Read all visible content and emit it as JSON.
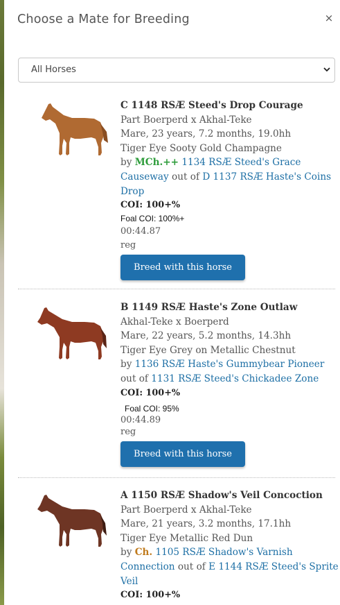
{
  "dialog": {
    "title": "Choose a Mate for Breeding",
    "close_label": "×"
  },
  "filter": {
    "selected": "All Horses"
  },
  "colors": {
    "link": "#1d6fa5",
    "button": "#1f70ad",
    "mch_badge": "#2e9c3b",
    "ch_badge": "#c07a1c"
  },
  "horses": [
    {
      "name": "C 1148 RSÆ Steed's Drop Courage",
      "breed": "Part Boerperd x Akhal-Teke",
      "details": "Mare, 23 years, 7.2 months, 19.0hh",
      "color": "Tiger Eye Sooty Gold Champagne",
      "by_label": "by",
      "sire_title": "MCh.++",
      "sire_line1": "1134 RSÆ Steed's Grace",
      "sire_line2": "Causeway",
      "out_of_label": "out of",
      "dam_line1": "D 1137 RSÆ Haste's Coins",
      "dam_line2": "Drop",
      "coi": "COI: 100+%",
      "foal_coi": "Foal COI: 100%+",
      "time": "00:44.87",
      "reg": "reg",
      "button": "Breed with this horse",
      "coat": "#b06a32"
    },
    {
      "name": "B 1149 RSÆ Haste's Zone Outlaw",
      "breed": "Akhal-Teke x Boerperd",
      "details": "Mare, 22 years, 5.2 months, 14.3hh",
      "color": "Tiger Eye Grey on Metallic Chestnut",
      "by_label": "by",
      "sire": "1136 RSÆ Haste's Gummybear Pioneer",
      "out_of_label": "out of",
      "dam": "1131 RSÆ Steed's Chickadee Zone",
      "coi": "COI: 100+%",
      "foal_coi": "Foal COI: 95%",
      "time": "00:44.89",
      "reg": "reg",
      "button": "Breed with this horse",
      "coat": "#8e3a22"
    },
    {
      "name": "A 1150 RSÆ Shadow's Veil Concoction",
      "breed": "Part Boerperd x Akhal-Teke",
      "details": "Mare, 21 years, 3.2 months, 17.1hh",
      "color": "Tiger Eye Metallic Red Dun",
      "by_label": "by",
      "sire_title": "Ch.",
      "sire_line1": "1105 RSÆ Shadow's Varnish",
      "sire_line2": "Connection",
      "out_of_label": "out of",
      "dam_line1": "E 1144 RSÆ Steed's Sprite",
      "dam_line2": "Veil",
      "coi": "COI: 100+%",
      "coat": "#6e3524"
    }
  ]
}
